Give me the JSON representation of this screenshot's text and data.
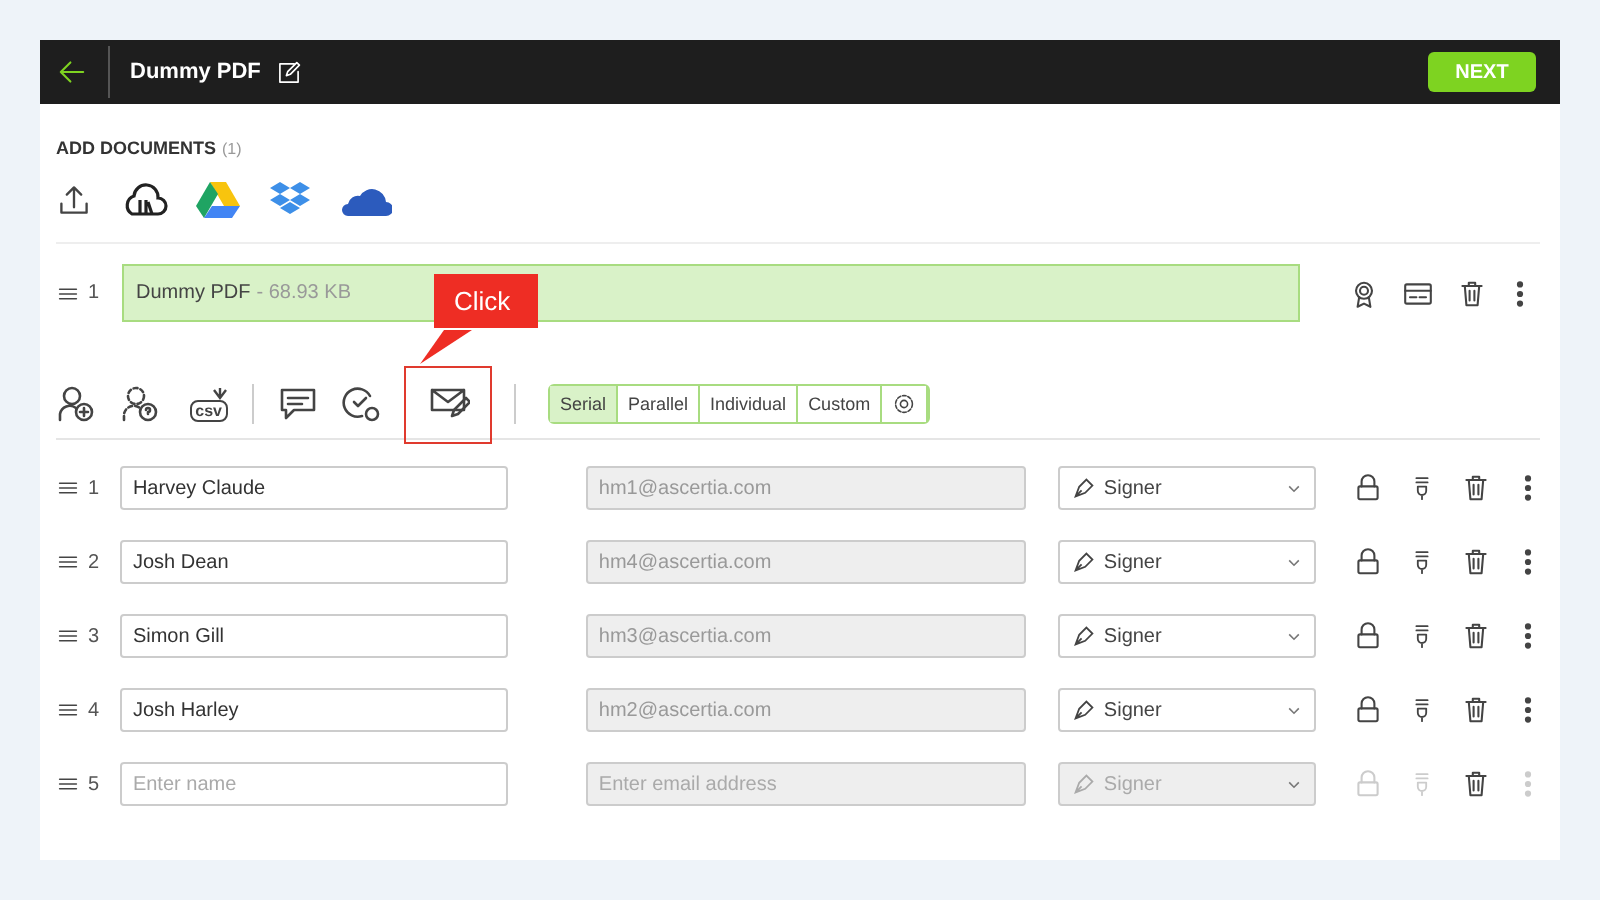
{
  "header": {
    "title": "Dummy PDF",
    "next_button": "NEXT"
  },
  "documents": {
    "heading": "ADD DOCUMENTS",
    "count": "(1)",
    "items": [
      {
        "index": "1",
        "name": "Dummy PDF",
        "size": "- 68.93 KB"
      }
    ]
  },
  "modes": [
    {
      "label": "Serial",
      "selected": true
    },
    {
      "label": "Parallel",
      "selected": false
    },
    {
      "label": "Individual",
      "selected": false
    },
    {
      "label": "Custom",
      "selected": false
    }
  ],
  "callout": {
    "text": "Click"
  },
  "csv_button": {
    "label": "csv"
  },
  "signers": [
    {
      "index": "1",
      "name": "Harvey Claude",
      "email": "hm1@ascertia.com",
      "role": "Signer",
      "disabled": false
    },
    {
      "index": "2",
      "name": "Josh Dean",
      "email": "hm4@ascertia.com",
      "role": "Signer",
      "disabled": false
    },
    {
      "index": "3",
      "name": "Simon Gill",
      "email": "hm3@ascertia.com",
      "role": "Signer",
      "disabled": false
    },
    {
      "index": "4",
      "name": "Josh Harley",
      "email": "hm2@ascertia.com",
      "role": "Signer",
      "disabled": false
    },
    {
      "index": "5",
      "name_placeholder": "Enter name",
      "email_placeholder": "Enter email address",
      "role": "Signer",
      "disabled": true
    }
  ]
}
